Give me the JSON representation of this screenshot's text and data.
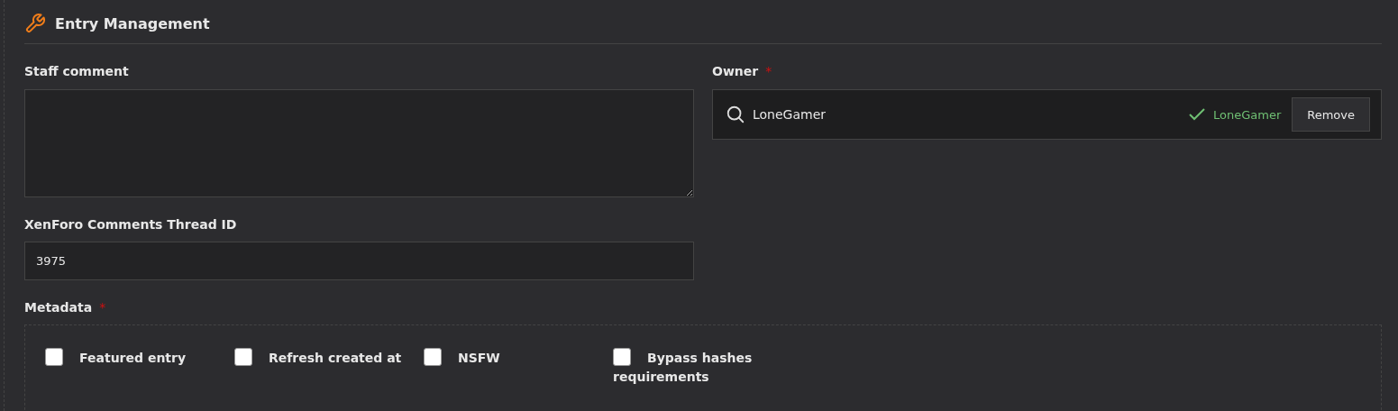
{
  "section": {
    "title": "Entry Management"
  },
  "staff_comment": {
    "label": "Staff comment"
  },
  "owner": {
    "label": "Owner",
    "required_mark": "*",
    "value": "LoneGamer",
    "status": "LoneGamer",
    "button": "Remove"
  },
  "thread_id": {
    "label": "XenForo Comments Thread ID",
    "value": "3975"
  },
  "metadata": {
    "label": "Metadata",
    "required_mark": "*",
    "options": [
      {
        "label": "Featured entry",
        "checked": false
      },
      {
        "label": "Refresh created at",
        "checked": false
      },
      {
        "label": "NSFW",
        "checked": false
      },
      {
        "label": "Bypass hashes requirements",
        "checked": false
      }
    ]
  }
}
